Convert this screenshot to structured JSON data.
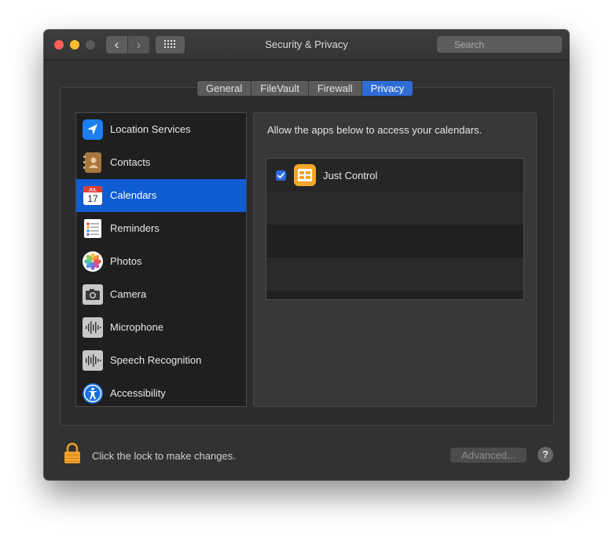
{
  "window": {
    "title": "Security & Privacy",
    "search_placeholder": "Search"
  },
  "tabs": [
    {
      "label": "General",
      "active": false
    },
    {
      "label": "FileVault",
      "active": false
    },
    {
      "label": "Firewall",
      "active": false
    },
    {
      "label": "Privacy",
      "active": true
    }
  ],
  "sidebar": {
    "items": [
      {
        "label": "Location Services",
        "icon": "location-arrow-icon"
      },
      {
        "label": "Contacts",
        "icon": "contacts-book-icon"
      },
      {
        "label": "Calendars",
        "icon": "calendar-icon",
        "selected": true,
        "icon_month": "JUL",
        "icon_day": "17"
      },
      {
        "label": "Reminders",
        "icon": "reminders-list-icon"
      },
      {
        "label": "Photos",
        "icon": "photos-flower-icon"
      },
      {
        "label": "Camera",
        "icon": "camera-icon"
      },
      {
        "label": "Microphone",
        "icon": "microphone-waveform-icon"
      },
      {
        "label": "Speech Recognition",
        "icon": "speech-waveform-icon"
      },
      {
        "label": "Accessibility",
        "icon": "accessibility-person-icon"
      }
    ]
  },
  "content": {
    "description": "Allow the apps below to access your calendars.",
    "apps": [
      {
        "name": "Just Control",
        "checked": true,
        "icon": "just-control-app-icon"
      }
    ]
  },
  "footer": {
    "lock_text": "Click the lock to make changes.",
    "advanced_label": "Advanced...",
    "help_label": "?"
  },
  "colors": {
    "accent": "#0f5cd3",
    "tab_active": "#2f6cd6",
    "app_icon": "#f4a62a",
    "lock": "#f2a02c"
  }
}
